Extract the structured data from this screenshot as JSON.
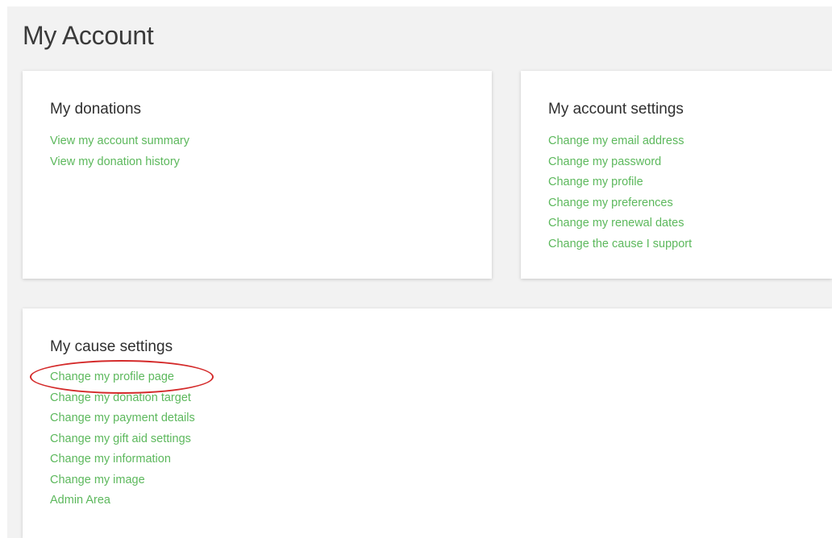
{
  "page": {
    "title": "My Account"
  },
  "donations": {
    "title": "My donations",
    "links": [
      "View my account summary",
      "View my donation history"
    ]
  },
  "account_settings": {
    "title": "My account settings",
    "links": [
      "Change my email address",
      "Change my password",
      "Change my profile",
      "Change my preferences",
      "Change my renewal dates",
      "Change the cause I support"
    ]
  },
  "cause_settings": {
    "title": "My cause settings",
    "links": [
      "Change my profile page",
      "Change my donation target",
      "Change my payment details",
      "Change my gift aid settings",
      "Change my information",
      "Change my image",
      "Admin Area"
    ]
  },
  "colors": {
    "link": "#5cb85c",
    "annotation": "#d42a2a",
    "background": "#f2f2f2"
  }
}
